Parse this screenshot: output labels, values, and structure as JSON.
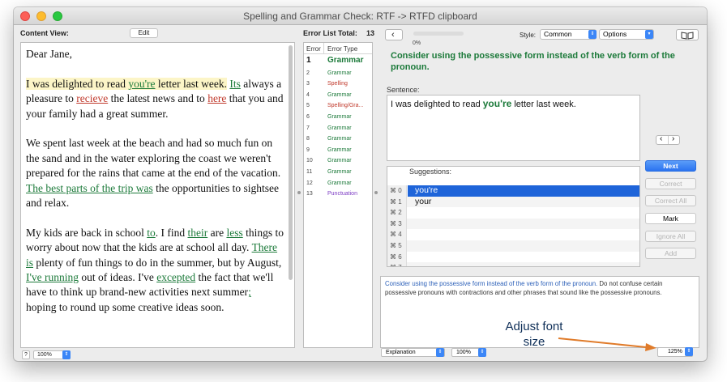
{
  "window": {
    "title": "Spelling and Grammar Check: RTF -> RTFD clipboard"
  },
  "content_view": {
    "label": "Content View:",
    "edit_button": "Edit",
    "zoom": "100%",
    "help": "?",
    "p1": "Dear Jane,",
    "p2": {
      "s1a": "I was delighted to read ",
      "s1err": "you're",
      "s1b": " letter last week.",
      "space": " ",
      "its": "Its",
      "b": " always a pleasure to ",
      "recieve": "recieve",
      "c": " the latest news and to ",
      "here": "here",
      "d": " that you and your family had a great summer."
    },
    "p3": {
      "a": "We spent last week at the beach and had so much fun on the sand and in the water exploring the coast we weren't prepared for the rains that came at the end of the vacation. ",
      "err": "The best parts of the trip was",
      "b": " the opportunities to sightsee and relax."
    },
    "p4": {
      "a": "My kids are back in school ",
      "to": "to",
      "b": ". I find ",
      "their": "their",
      "c": " are ",
      "less": "less",
      "d": " things to worry about now that the kids are at school all day. ",
      "there_is": "There is",
      "e": " plenty of fun things to do in the summer, but by August, ",
      "ive_running": "I've running",
      "f": " out of ideas. I've ",
      "excepted": "excepted",
      "g": " the fact that we'll have to think up brand-new activities next summer",
      "semi": ";",
      "h": " hoping to round up some creative ideas soon."
    }
  },
  "error_list": {
    "total_label": "Error List Total:",
    "total": "13",
    "col_error": "Error",
    "col_type": "Error Type",
    "rows": [
      {
        "num": "1",
        "type": "Grammar",
        "kind": "grammar",
        "bold": true
      },
      {
        "num": "2",
        "type": "Grammar",
        "kind": "grammar"
      },
      {
        "num": "3",
        "type": "Spelling",
        "kind": "spelling"
      },
      {
        "num": "4",
        "type": "Grammar",
        "kind": "grammar"
      },
      {
        "num": "5",
        "type": "Spelling/Gra...",
        "kind": "spelling"
      },
      {
        "num": "6",
        "type": "Grammar",
        "kind": "grammar"
      },
      {
        "num": "7",
        "type": "Grammar",
        "kind": "grammar"
      },
      {
        "num": "8",
        "type": "Grammar",
        "kind": "grammar"
      },
      {
        "num": "9",
        "type": "Grammar",
        "kind": "grammar"
      },
      {
        "num": "10",
        "type": "Grammar",
        "kind": "grammar"
      },
      {
        "num": "11",
        "type": "Grammar",
        "kind": "grammar"
      },
      {
        "num": "12",
        "type": "Grammar",
        "kind": "grammar"
      },
      {
        "num": "13",
        "type": "Punctuation",
        "kind": "punct"
      }
    ]
  },
  "checker": {
    "progress_label": "0%",
    "progress_value": 0,
    "style_label": "Style:",
    "style_value": "Common",
    "options_label": "Options",
    "message": "Consider using the possessive form instead of the verb form of the pronoun.",
    "sentence_label": "Sentence:",
    "sentence_a": "I was delighted to read ",
    "sentence_err": "you're",
    "sentence_b": " letter last week.",
    "suggestions_label": "Suggestions:",
    "suggestions": [
      {
        "key": "⌘ 0",
        "text": "you're",
        "selected": true
      },
      {
        "key": "⌘ 1",
        "text": "your"
      },
      {
        "key": "⌘ 2",
        "text": ""
      },
      {
        "key": "⌘ 3",
        "text": ""
      },
      {
        "key": "⌘ 4",
        "text": ""
      },
      {
        "key": "⌘ 5",
        "text": ""
      },
      {
        "key": "⌘ 6",
        "text": ""
      },
      {
        "key": "⌘ 7",
        "text": ""
      }
    ],
    "buttons": {
      "next": "Next",
      "correct": "Correct",
      "correct_all": "Correct All",
      "mark": "Mark",
      "ignore_all": "Ignore All",
      "add": "Add"
    },
    "explanation_first": "Consider using the possessive form instead of the verb form of the pronoun.",
    "explanation_rest": "  Do not confuse certain possessive pronouns with contractions and other phrases that sound like the possessive pronouns.",
    "bottom_popup": "Explanation",
    "bottom_zoom": "100%",
    "font_zoom": "125%"
  },
  "annotation": {
    "text": "Adjust font size",
    "color": "#e07b2a"
  }
}
